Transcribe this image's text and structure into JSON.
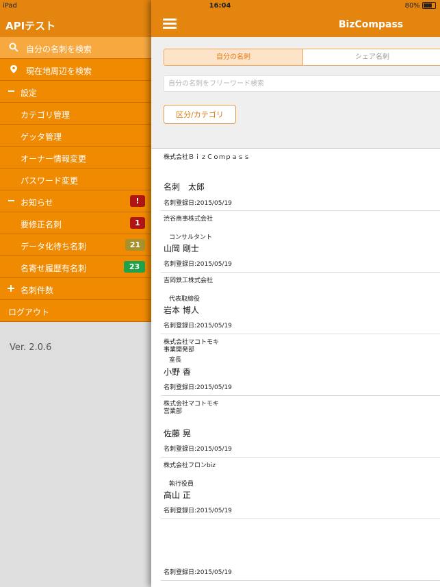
{
  "status": {
    "device": "iPad",
    "time": "16:04",
    "battery": "80%"
  },
  "sidebar": {
    "title": "APIテスト",
    "items": [
      {
        "label": "自分の名刺を検索",
        "icon": "search-icon"
      },
      {
        "label": "現在地周辺を検索",
        "icon": "location-pin-icon"
      },
      {
        "label": "設定",
        "icon": "minus-icon"
      },
      {
        "label": "カテゴリ管理"
      },
      {
        "label": "ゲッタ管理"
      },
      {
        "label": "オーナー情報変更"
      },
      {
        "label": "パスワード変更"
      },
      {
        "label": "お知らせ",
        "icon": "minus-icon",
        "badge": "!"
      },
      {
        "label": "要修正名刺",
        "badge": "1"
      },
      {
        "label": "データ化待ち名刺",
        "badge": "21"
      },
      {
        "label": "名寄せ履歴有名刺",
        "badge": "23"
      },
      {
        "label": "名刺件数",
        "icon": "plus-icon"
      },
      {
        "label": "ログアウト"
      }
    ],
    "version": "Ver. 2.0.6"
  },
  "main": {
    "title": "BizCompass",
    "tabs": [
      "自分の名刺",
      "シェア名刺"
    ],
    "search_placeholder": "自分の名刺をフリーワード検索",
    "category_button": "区分/カテゴリ",
    "cards": [
      {
        "company": "株式会社ＢｉｚＣｏｍｐａｓｓ",
        "role": "",
        "name": "名刺　太郎",
        "date": "名刺登録日:2015/05/19"
      },
      {
        "company": "渋谷商事株式会社",
        "role": "コンサルタント",
        "name": "山岡 剛士",
        "date": "名刺登録日:2015/05/19"
      },
      {
        "company": "吉岡鉄工株式会社",
        "role": "代表取締役",
        "name": "岩本 博人",
        "date": "名刺登録日:2015/05/19"
      },
      {
        "company": "株式会社マコトモキ\n事業開発部",
        "role": "室長",
        "name": "小野 香",
        "date": "名刺登録日:2015/05/19"
      },
      {
        "company": "株式会社マコトモキ\n営業部",
        "role": "",
        "name": "佐藤 晃",
        "date": "名刺登録日:2015/05/19"
      },
      {
        "company": "株式会社フロンbiz",
        "role": "執行役員",
        "name": "高山 正",
        "date": "名刺登録日:2015/05/19"
      },
      {
        "company": "",
        "role": "",
        "name": "",
        "date": "名刺登録日:2015/05/19"
      }
    ]
  },
  "colors": {
    "header": "#e3850e",
    "sidebar_item": "#f08a00",
    "badge_red": "#b01515",
    "badge_olive": "#a8922b",
    "badge_green": "#1fa34a"
  }
}
